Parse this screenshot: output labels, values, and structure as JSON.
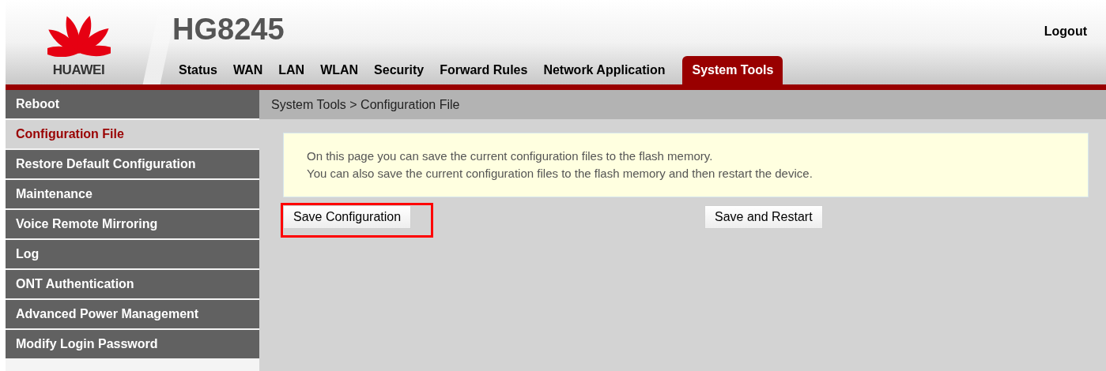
{
  "logo": {
    "text": "HUAWEI"
  },
  "model": "HG8245",
  "logout": "Logout",
  "tabs": [
    {
      "label": "Status",
      "selected": false
    },
    {
      "label": "WAN",
      "selected": false
    },
    {
      "label": "LAN",
      "selected": false
    },
    {
      "label": "WLAN",
      "selected": false
    },
    {
      "label": "Security",
      "selected": false
    },
    {
      "label": "Forward Rules",
      "selected": false
    },
    {
      "label": "Network Application",
      "selected": false
    },
    {
      "label": "System Tools",
      "selected": true
    }
  ],
  "sidebar": {
    "items": [
      {
        "label": "Reboot",
        "selected": false
      },
      {
        "label": "Configuration File",
        "selected": true
      },
      {
        "label": "Restore Default Configuration",
        "selected": false
      },
      {
        "label": "Maintenance",
        "selected": false
      },
      {
        "label": "Voice Remote Mirroring",
        "selected": false
      },
      {
        "label": "Log",
        "selected": false
      },
      {
        "label": "ONT Authentication",
        "selected": false
      },
      {
        "label": "Advanced Power Management",
        "selected": false
      },
      {
        "label": "Modify Login Password",
        "selected": false
      }
    ]
  },
  "breadcrumb": "System Tools > Configuration File",
  "info": [
    "On this page you can save the current configuration files to the flash memory.",
    "You can also save the current configuration files to the flash memory and then restart the device."
  ],
  "buttons": [
    {
      "label": "Save Configuration",
      "highlighted": true
    },
    {
      "label": "Save and Restart",
      "highlighted": false
    }
  ]
}
